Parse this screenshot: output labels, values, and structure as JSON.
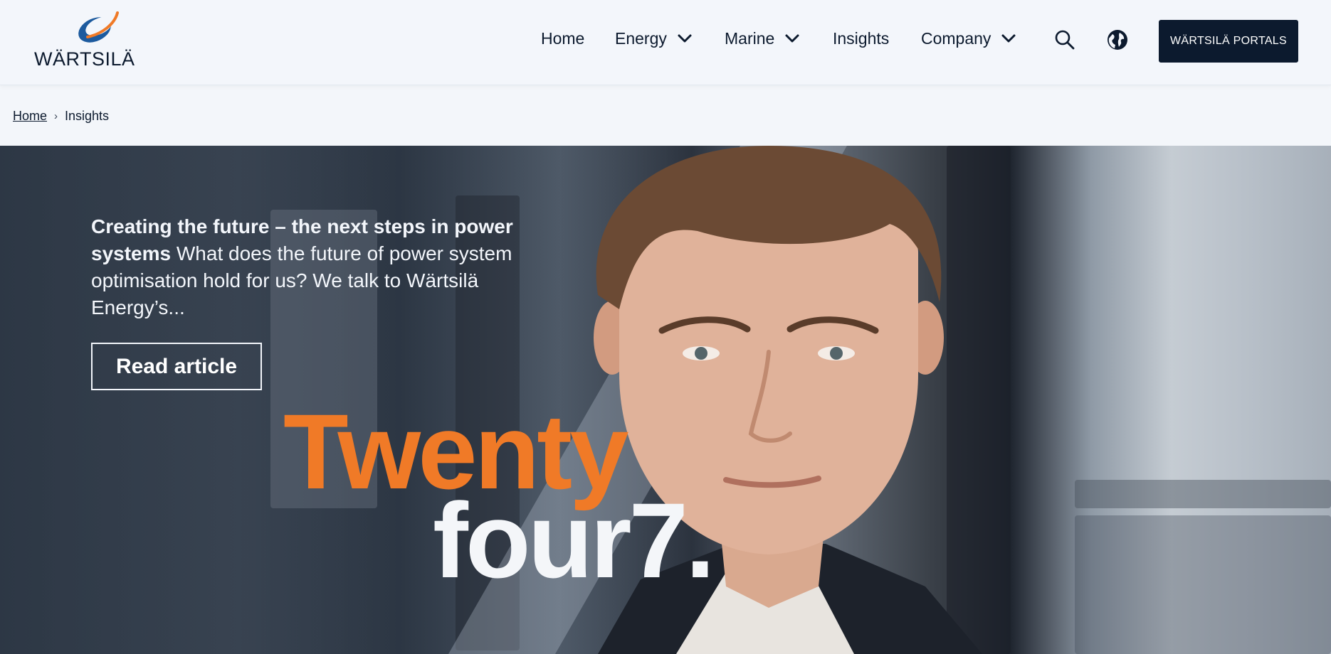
{
  "header": {
    "logo_text": "WÄRTSILÄ",
    "nav": [
      {
        "label": "Home",
        "has_dropdown": false
      },
      {
        "label": "Energy",
        "has_dropdown": true
      },
      {
        "label": "Marine",
        "has_dropdown": true
      },
      {
        "label": "Insights",
        "has_dropdown": false
      },
      {
        "label": "Company",
        "has_dropdown": true
      }
    ],
    "icons": [
      "search-icon",
      "globe-icon"
    ],
    "portals_label": "WÄRTSILÄ PORTALS"
  },
  "breadcrumb": {
    "home": "Home",
    "current": "Insights"
  },
  "hero": {
    "headline": "Creating the future – the next steps in power systems",
    "teaser": "What does the future of power system optimisation hold for us? We talk to Wärtsilä Energy’s...",
    "cta_label": "Read article",
    "brand_line1": "Twenty",
    "brand_line2": "four7."
  },
  "colors": {
    "navy": "#0c1a2e",
    "accent_orange": "#f07a27",
    "logo_blue": "#1c5a9e",
    "header_bg": "#f3f6fb"
  }
}
